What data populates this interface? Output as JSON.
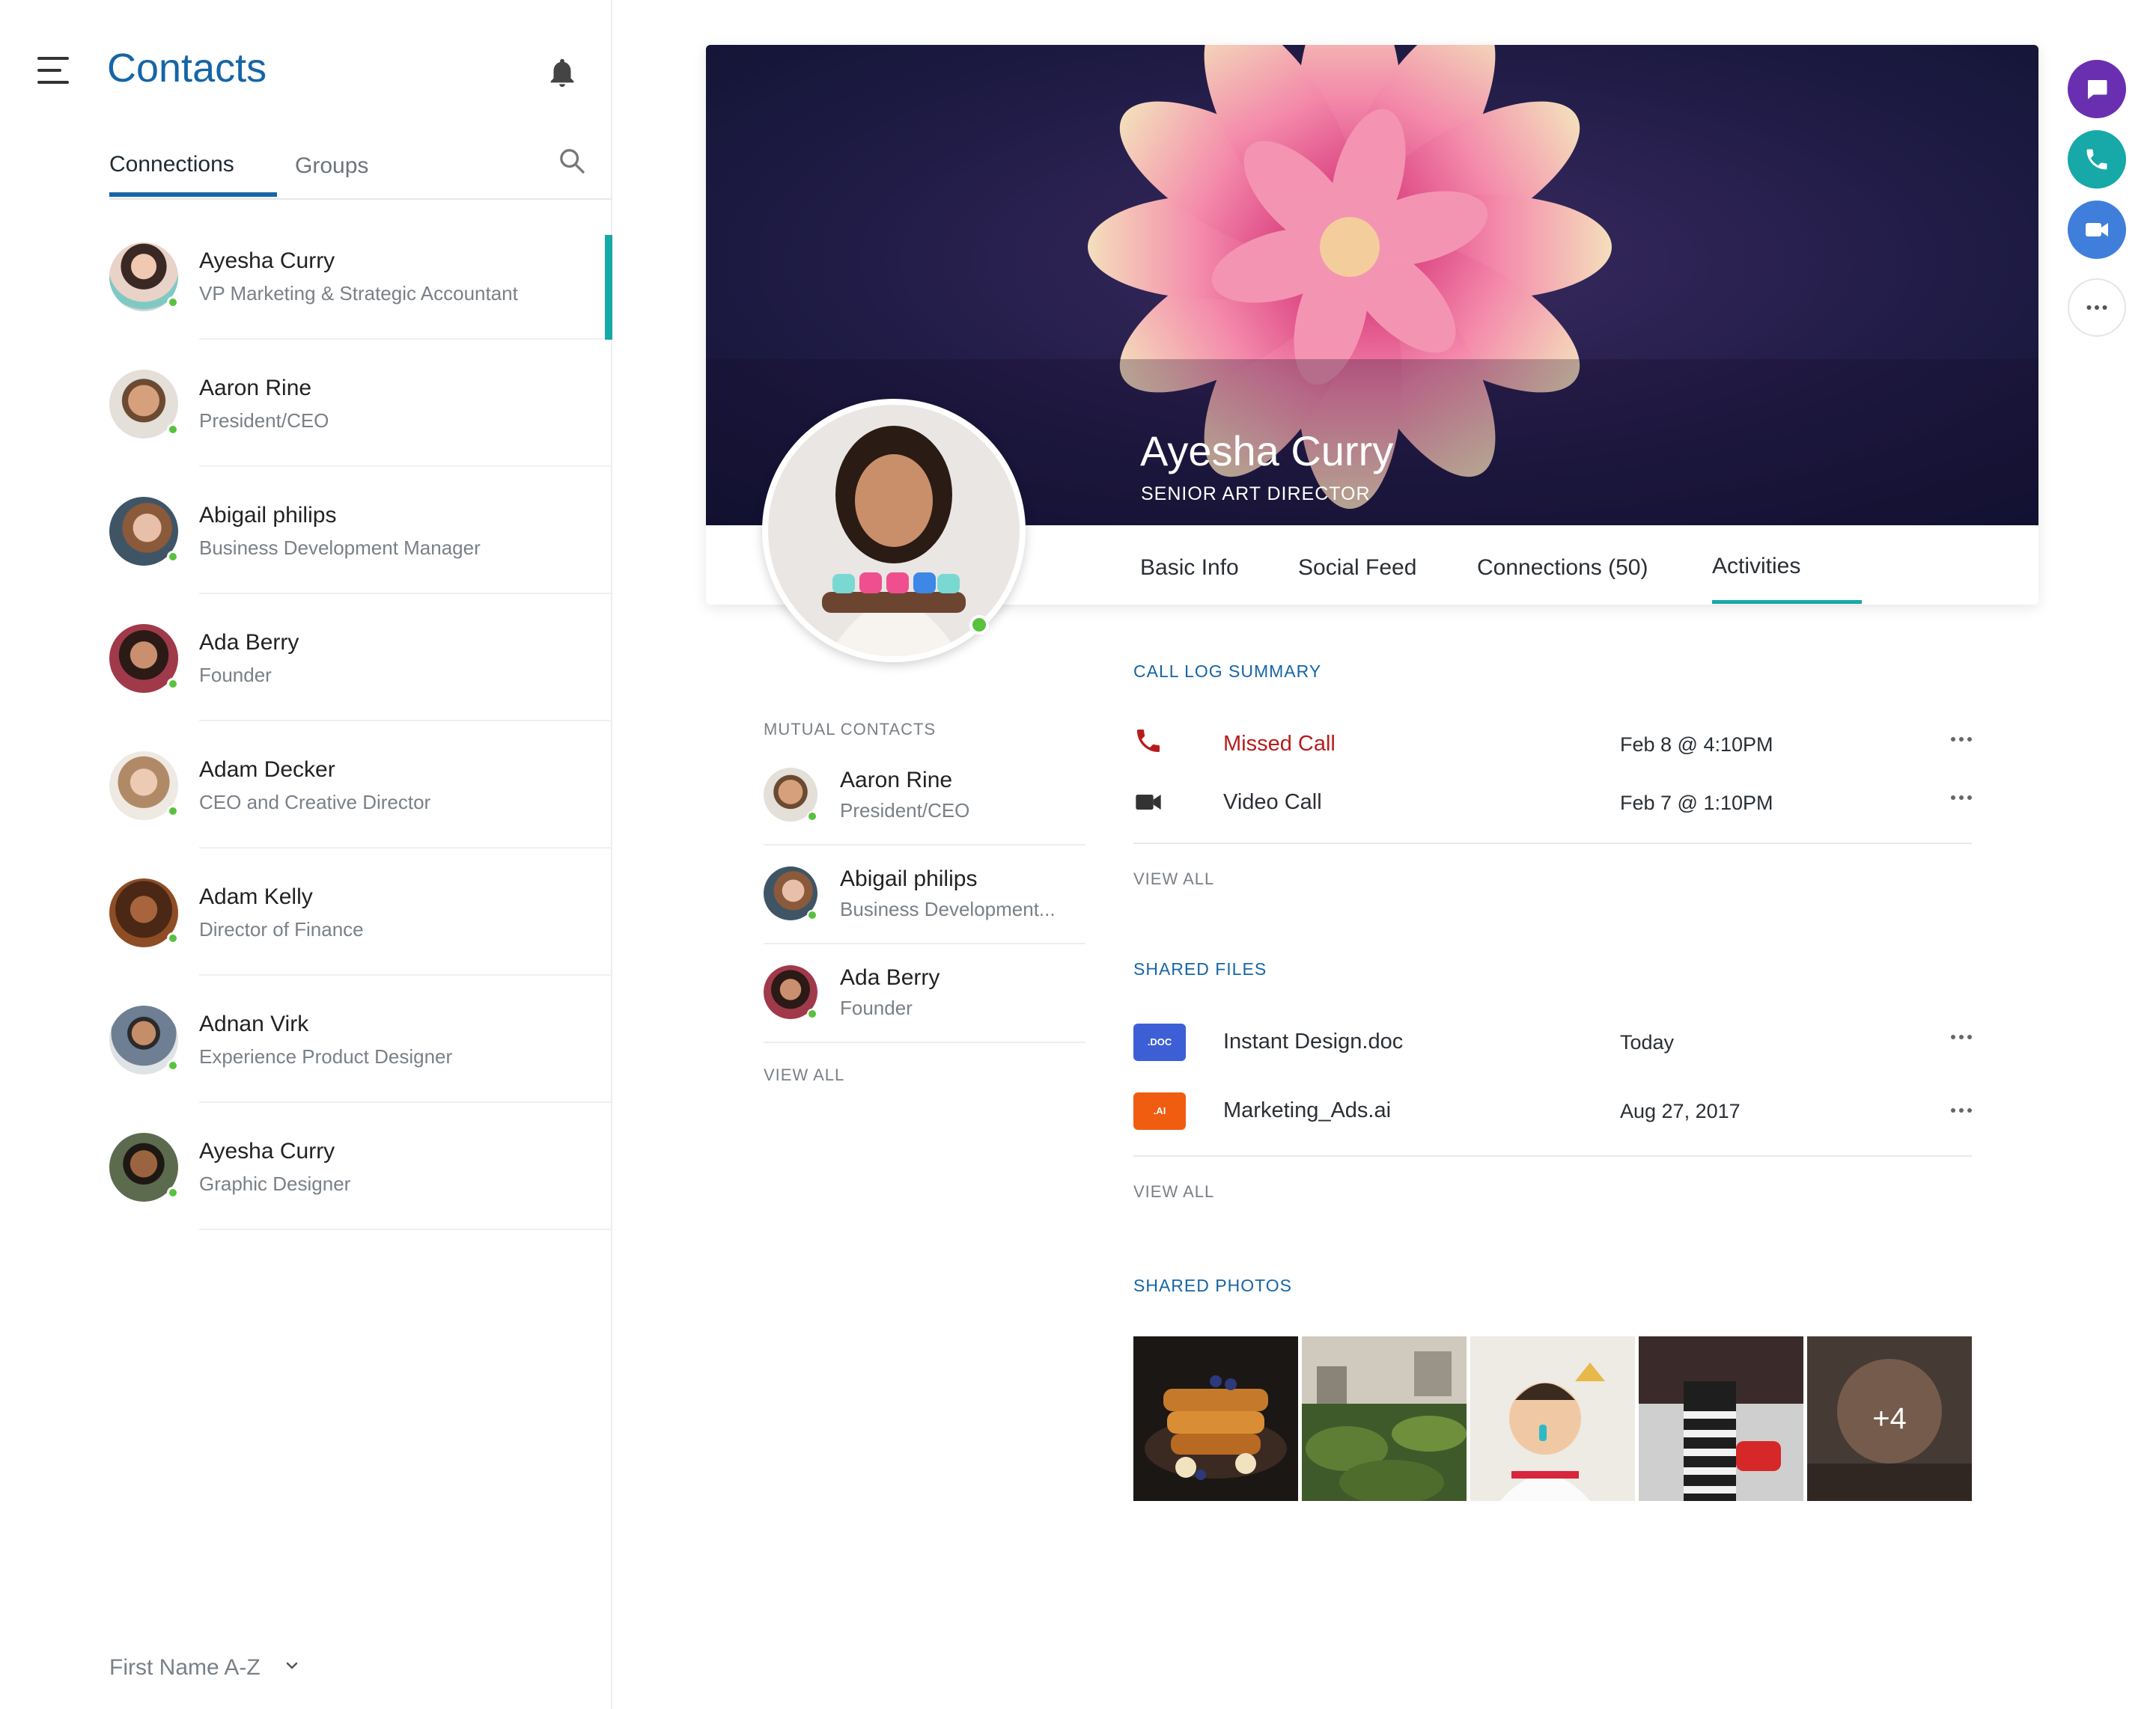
{
  "sidebar": {
    "title": "Contacts",
    "tabs": {
      "connections": "Connections",
      "groups": "Groups"
    },
    "contacts": [
      {
        "name": "Ayesha Curry",
        "role": "VP Marketing & Strategic Accountant"
      },
      {
        "name": "Aaron Rine",
        "role": "President/CEO"
      },
      {
        "name": "Abigail philips",
        "role": "Business Development Manager"
      },
      {
        "name": "Ada Berry",
        "role": "Founder"
      },
      {
        "name": "Adam Decker",
        "role": "CEO and Creative Director"
      },
      {
        "name": "Adam Kelly",
        "role": "Director of Finance"
      },
      {
        "name": "Adnan Virk",
        "role": "Experience Product Designer"
      },
      {
        "name": "Ayesha Curry",
        "role": "Graphic Designer"
      }
    ],
    "sort_label": "First Name A-Z"
  },
  "profile": {
    "name": "Ayesha Curry",
    "title": "SENIOR ART DIRECTOR",
    "tabs": [
      "Basic Info",
      "Social Feed",
      "Connections (50)",
      "Activities"
    ],
    "active_tab": "Activities"
  },
  "mutual_contacts": {
    "label": "MUTUAL CONTACTS",
    "items": [
      {
        "name": "Aaron Rine",
        "role": "President/CEO"
      },
      {
        "name": "Abigail philips",
        "role": "Business Development..."
      },
      {
        "name": "Ada Berry",
        "role": "Founder"
      }
    ],
    "view_all": "VIEW ALL"
  },
  "call_log": {
    "label": "CALL LOG SUMMARY",
    "items": [
      {
        "type": "Missed Call",
        "icon": "phone-icon",
        "date": "Feb 8  @ 4:10PM"
      },
      {
        "type": "Video Call",
        "icon": "video-camera-icon",
        "date": "Feb 7  @ 1:10PM"
      }
    ],
    "view_all": "VIEW ALL"
  },
  "shared_files": {
    "label": "SHARED FILES",
    "items": [
      {
        "badge": ".DOC",
        "name": "Instant Design.doc",
        "date": "Today"
      },
      {
        "badge": ".AI",
        "name": "Marketing_Ads.ai",
        "date": "Aug 27, 2017"
      }
    ],
    "view_all": "VIEW ALL"
  },
  "shared_photos": {
    "label": "SHARED PHOTOS",
    "more_count": "+4"
  },
  "actions": [
    "chat-icon",
    "phone-icon",
    "video-camera-icon",
    "more-icon"
  ],
  "colors": {
    "primary": "#1565a7",
    "accent_teal": "#17a8a8",
    "online": "#58c13d",
    "missed": "#b71c1c",
    "chat_fab": "#6a2fb0",
    "phone_fab": "#17a8a8",
    "video_fab": "#3f7fdb"
  }
}
